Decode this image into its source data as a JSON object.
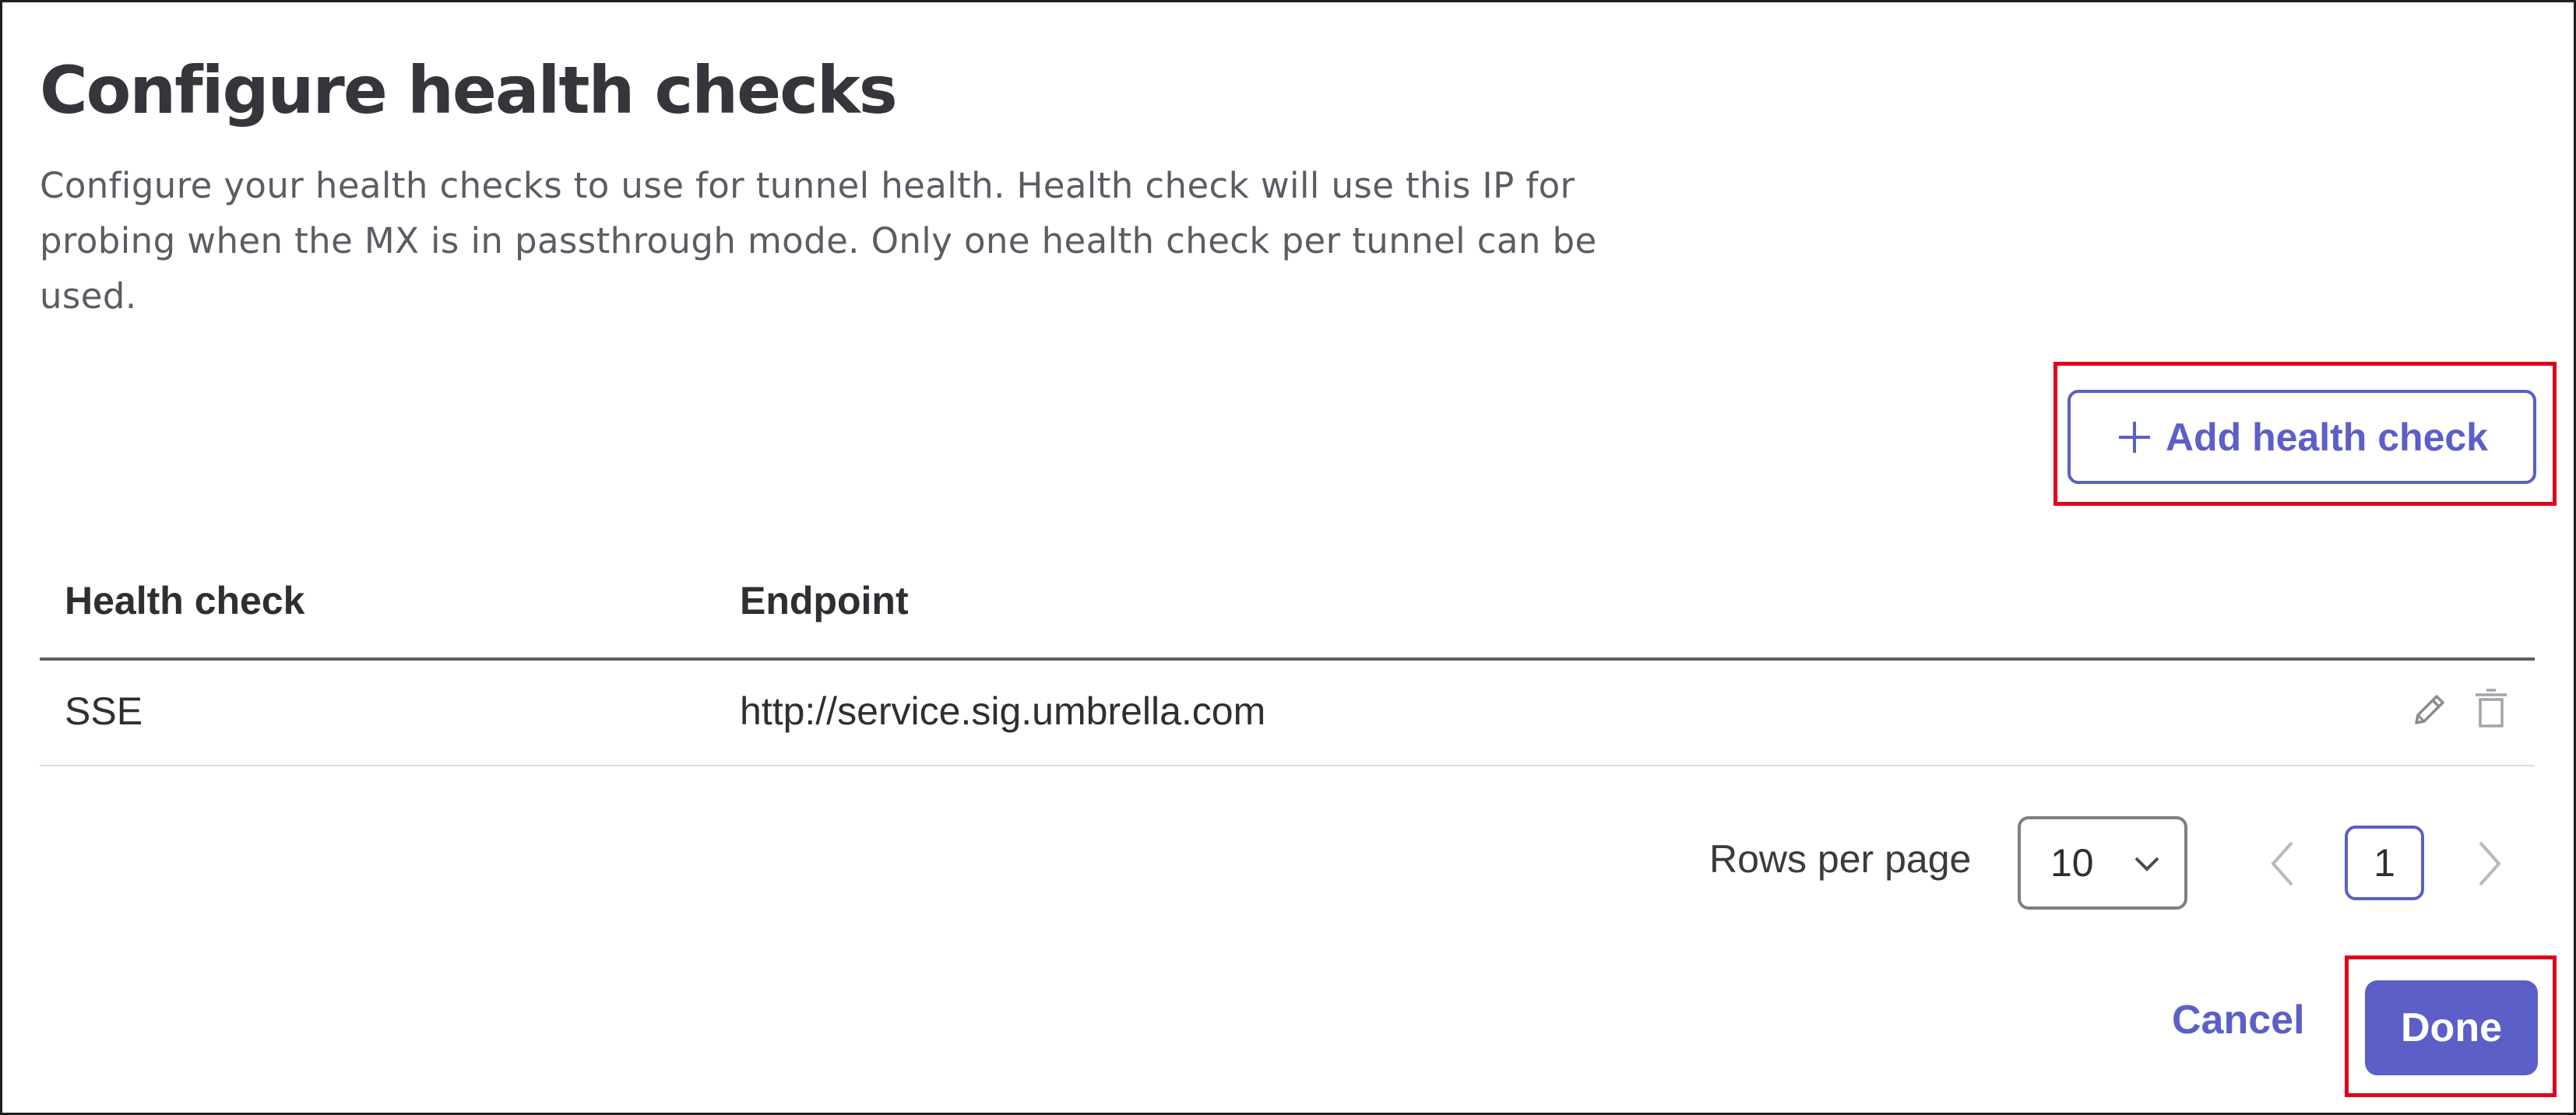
{
  "dialog": {
    "title": "Configure health checks",
    "description": "Configure your health checks to use for tunnel health. Health check will use this IP for probing when the MX is in passthrough mode. Only one health check per tunnel can be used."
  },
  "actions": {
    "add_label": "Add health check",
    "add_icon": "plus-icon"
  },
  "table": {
    "columns": [
      "Health check",
      "Endpoint"
    ],
    "rows": [
      {
        "health_check": "SSE",
        "endpoint": "http://service.sig.umbrella.com",
        "row_icons": [
          "edit-icon",
          "trash-icon"
        ]
      }
    ]
  },
  "pagination": {
    "rows_per_page_label": "Rows per page",
    "rows_per_page_value": "10",
    "current_page": "1"
  },
  "footer": {
    "cancel_label": "Cancel",
    "done_label": "Done"
  },
  "colors": {
    "accent": "#5b5fc7",
    "highlight_box": "#e0001a"
  }
}
